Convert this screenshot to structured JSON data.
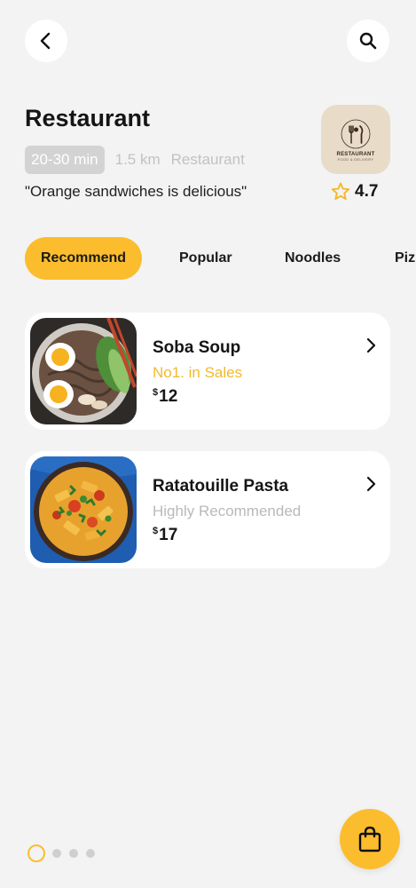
{
  "header": {
    "back_icon": "back-arrow-icon",
    "search_icon": "search-icon"
  },
  "restaurant": {
    "title": "Restaurant",
    "time_chip": "20-30 min",
    "distance": "1.5 km",
    "category": "Restaurant",
    "tagline": "\"Orange sandwiches is delicious\"",
    "rating": "4.7",
    "logo": {
      "title": "RESTAURANT",
      "subtitle": "FOOD & DELIVERY"
    }
  },
  "tabs": [
    {
      "label": "Recommend",
      "active": true
    },
    {
      "label": "Popular",
      "active": false
    },
    {
      "label": "Noodles",
      "active": false
    },
    {
      "label": "Piz",
      "active": false
    }
  ],
  "items": [
    {
      "name": "Soba Soup",
      "subtitle": "No1. in Sales",
      "subtitle_color": "#f2b92c",
      "currency": "$",
      "price": "12"
    },
    {
      "name": "Ratatouille Pasta",
      "subtitle": "Highly Recommended",
      "subtitle_color": "#b9b9b9",
      "currency": "$",
      "price": "17"
    }
  ],
  "pager": {
    "total": 4,
    "active": 1
  },
  "cart": {
    "icon": "shopping-bag-icon"
  },
  "colors": {
    "accent": "#fbbd2e",
    "background": "#f3f3f3",
    "card": "#ffffff"
  }
}
